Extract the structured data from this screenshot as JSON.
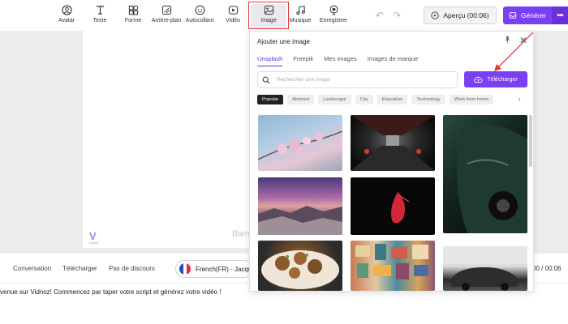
{
  "toolbar": {
    "tools": [
      {
        "label": "Avatar",
        "icon": "avatar-icon"
      },
      {
        "label": "Texte",
        "icon": "text-icon"
      },
      {
        "label": "Forme",
        "icon": "shapes-icon"
      },
      {
        "label": "Arrière-plan",
        "icon": "background-icon"
      },
      {
        "label": "Autocollant",
        "icon": "sticker-icon"
      },
      {
        "label": "Vidéo",
        "icon": "video-icon"
      },
      {
        "label": "Image",
        "icon": "image-icon"
      },
      {
        "label": "Musique",
        "icon": "music-icon"
      },
      {
        "label": "Enregistrer",
        "icon": "record-icon"
      }
    ],
    "preview_label": "Aperçu (00:06)",
    "generate_label": "Générer"
  },
  "canvas": {
    "watermark_text": "V",
    "watermark_sub": "Vidnoz",
    "caption_text": "Bien"
  },
  "bottom": {
    "tabs": [
      "Conversation",
      "Télécharger",
      "Pas de discours"
    ],
    "language": "French(FR) - Jacque",
    "time": "00 / 00:06",
    "welcome": "venue sur Vidnoz! Commencez par taper votre script et générez votre vidéo !"
  },
  "panel": {
    "title": "Ajouter une image",
    "tabs": [
      "Unsplash",
      "Freepik",
      "Mes images",
      "Images de marque"
    ],
    "active_tab": "Unsplash",
    "search_placeholder": "Rechercher une image",
    "upload_label": "Télécharger",
    "chips": [
      "Popular",
      "Abstract",
      "Landscape",
      "City",
      "Education",
      "Technology",
      "Work from home"
    ],
    "active_chip": "Popular"
  },
  "colors": {
    "accent": "#7b3ff2",
    "highlight": "#e53935"
  }
}
